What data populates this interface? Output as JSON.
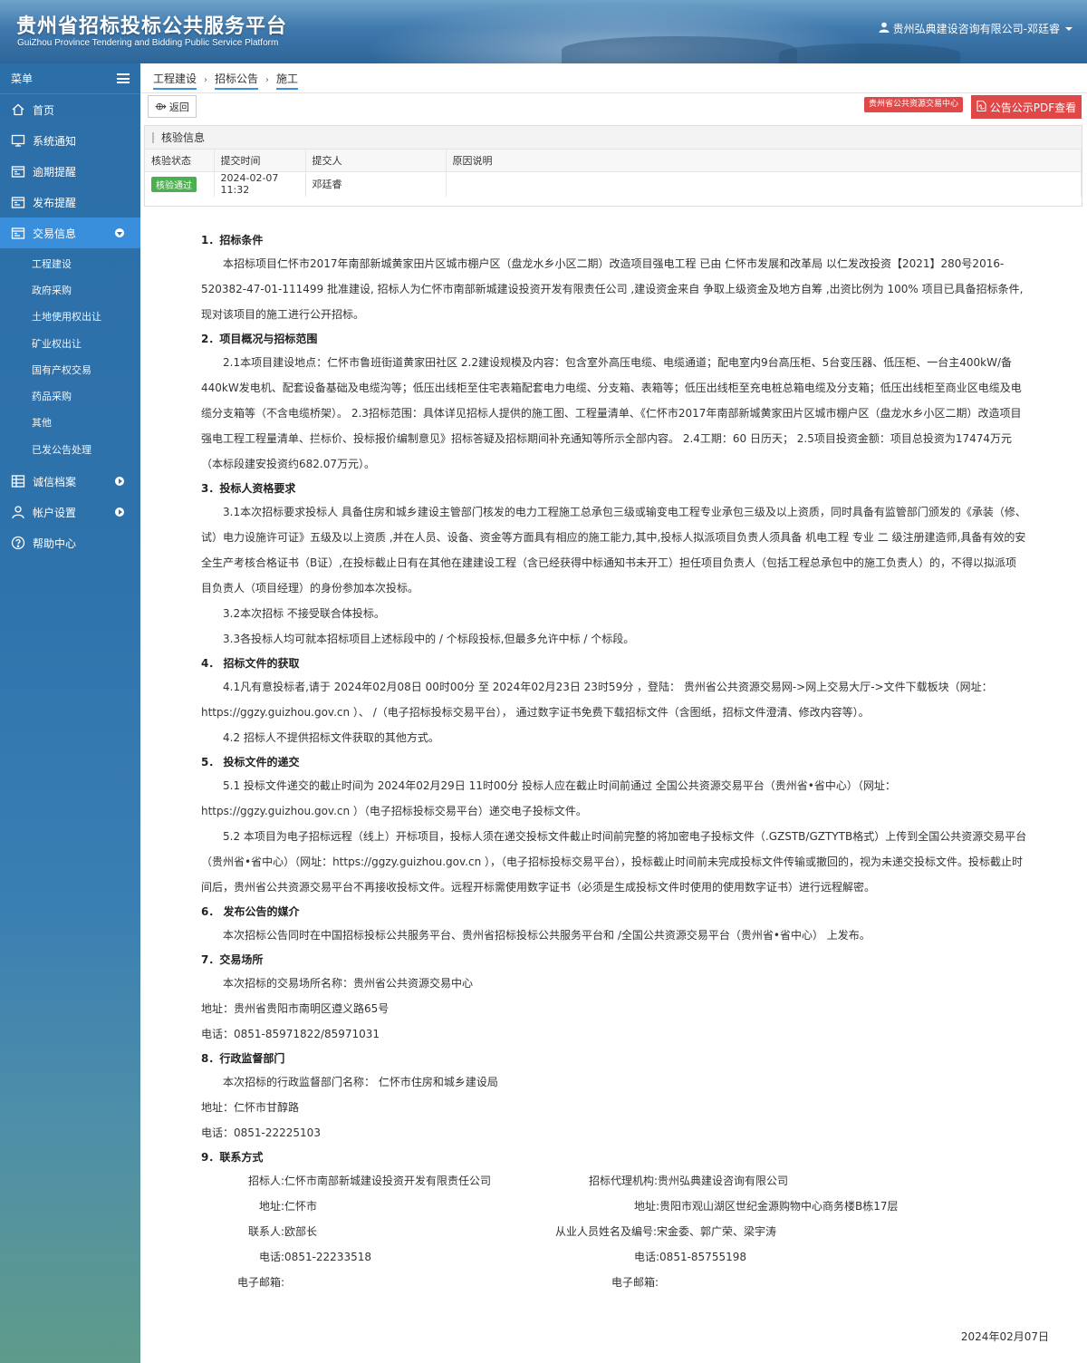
{
  "header": {
    "title": "贵州省招标投标公共服务平台",
    "subtitle": "GuiZhou Province Tendering and Bidding Public Service Platform",
    "user": "贵州弘典建设咨询有限公司-邓廷睿"
  },
  "sidebar": {
    "title": "菜单",
    "items": [
      {
        "label": "首页",
        "icon": "home-icon"
      },
      {
        "label": "系统通知",
        "icon": "monitor-icon"
      },
      {
        "label": "逾期提醒",
        "icon": "calendar-icon"
      },
      {
        "label": "发布提醒",
        "icon": "calendar-icon"
      },
      {
        "label": "交易信息",
        "icon": "calendar-icon"
      },
      {
        "label": "诚信档案",
        "icon": "grid-icon"
      },
      {
        "label": "帐户设置",
        "icon": "user-icon"
      },
      {
        "label": "帮助中心",
        "icon": "help-icon"
      }
    ],
    "sub_items": [
      "工程建设",
      "政府采购",
      "土地使用权出让",
      "矿业权出让",
      "国有产权交易",
      "药品采购",
      "其他",
      "已发公告处理"
    ]
  },
  "breadcrumb": [
    "工程建设",
    "招标公告",
    "施工"
  ],
  "toolbar": {
    "back": "返回",
    "source_tag": "贵州省公共资源交易中心",
    "pdf": "公告公示PDF查看"
  },
  "verify": {
    "title": "核验信息",
    "headers": [
      "核验状态",
      "提交时间",
      "提交人",
      "原因说明"
    ],
    "row": {
      "status": "核验通过",
      "time": "2024-02-07 11:32",
      "submitter": "邓廷睿",
      "reason": ""
    }
  },
  "notice": {
    "s1_title": "1．招标条件",
    "s1_p1": "本招标项目仁怀市2017年南部新城黄家田片区城市棚户区（盘龙水乡小区二期）改造项目强电工程 已由 仁怀市发展和改革局 以仁发改投资【2021】280号2016-520382-47-01-111499 批准建设, 招标人为仁怀市南部新城建设投资开发有限责任公司 ,建设资金来自 争取上级资金及地方自筹 ,出资比例为 100% 项目已具备招标条件,现对该项目的施工进行公开招标。",
    "s2_title": "2．项目概况与招标范围",
    "s2_p1": "2.1本项目建设地点：仁怀市鲁班街道黄家田社区 2.2建设规模及内容：包含室外高压电缆、电缆通道；配电室内9台高压柜、5台变压器、低压柜、一台主400kW/备440kW发电机、配套设备基础及电缆沟等；低压出线柜至住宅表箱配套电力电缆、分支箱、表箱等；低压出线柜至充电桩总箱电缆及分支箱；低压出线柜至商业区电缆及电缆分支箱等（不含电缆桥架）。 2.3招标范围：具体详见招标人提供的施工图、工程量清单、《仁怀市2017年南部新城黄家田片区城市棚户区（盘龙水乡小区二期）改造项目强电工程工程量清单、拦标价、投标报价编制意见》招标答疑及招标期间补充通知等所示全部内容。 2.4工期：60 日历天； 2.5项目投资金额：项目总投资为17474万元（本标段建安投资约682.07万元）。",
    "s3_title": "3．投标人资格要求",
    "s3_p1": "3.1本次招标要求投标人 具备住房和城乡建设主管部门核发的电力工程施工总承包三级或输变电工程专业承包三级及以上资质，同时具备有监管部门颁发的《承装（修、试）电力设施许可证》五级及以上资质 ,并在人员、设备、资金等方面具有相应的施工能力,其中,投标人拟派项目负责人须具备 机电工程 专业 二 级注册建造师,具备有效的安全生产考核合格证书（B证）,在投标截止日有在其他在建建设工程（含已经获得中标通知书未开工）担任项目负责人（包括工程总承包中的施工负责人）的，不得以拟派项目负责人（项目经理）的身份参加本次投标。",
    "s3_p2": "3.2本次招标 不接受联合体投标。",
    "s3_p3": "3.3各投标人均可就本招标项目上述标段中的 / 个标段投标,但最多允许中标 / 个标段。",
    "s4_title": "4． 招标文件的获取",
    "s4_p1": "4.1凡有意投标者,请于 2024年02月08日 00时00分 至 2024年02月23日 23时59分 ，登陆： 贵州省公共资源交易网->网上交易大厅->文件下载板块（网址：https://ggzy.guizhou.gov.cn ）、 /（电子招标投标交易平台）， 通过数字证书免费下载招标文件（含图纸，招标文件澄清、修改内容等）。",
    "s4_p2": "4.2 招标人不提供招标文件获取的其他方式。",
    "s5_title": "5． 投标文件的递交",
    "s5_p1": "5.1 投标文件递交的截止时间为 2024年02月29日 11时00分 投标人应在截止时间前通过 全国公共资源交易平台（贵州省•省中心）（网址：https://ggzy.guizhou.gov.cn ）（电子招标投标交易平台）递交电子投标文件。",
    "s5_p2": "5.2 本项目为电子招标远程（线上）开标项目，投标人须在递交投标文件截止时间前完整的将加密电子投标文件（.GZSTB/GZTYTB格式）上传到全国公共资源交易平台（贵州省•省中心）（网址：https://ggzy.guizhou.gov.cn ），（电子招标投标交易平台），投标截止时间前未完成投标文件传输或撤回的，视为未递交投标文件。投标截止时间后，贵州省公共资源交易平台不再接收投标文件。远程开标需使用数字证书（必须是生成投标文件时使用的使用数字证书）进行远程解密。",
    "s6_title": "6． 发布公告的媒介",
    "s6_p1": "本次招标公告同时在中国招标投标公共服务平台、贵州省招标投标公共服务平台和 /全国公共资源交易平台（贵州省•省中心） 上发布。",
    "s7_title": "7．交易场所",
    "s7_p1": "本次招标的交易场所名称：贵州省公共资源交易中心",
    "s7_p2": "地址：贵州省贵阳市南明区遵义路65号",
    "s7_p3": "电话：0851-85971822/85971031",
    "s8_title": "8．行政监督部门",
    "s8_p1": "本次招标的行政监督部门名称： 仁怀市住房和城乡建设局",
    "s8_p2": "地址：仁怀市甘醇路",
    "s8_p3": "电话：0851-22225103",
    "s9_title": "9．联系方式",
    "contact_left": [
      "招标人:仁怀市南部新城建设投资开发有限责任公司",
      "地址:仁怀市",
      "联系人:欧部长",
      "电话:0851-22233518",
      "电子邮箱:"
    ],
    "contact_right": [
      "招标代理机构:贵州弘典建设咨询有限公司",
      "地址:贵阳市观山湖区世纪金源购物中心商务楼B栋17层",
      "从业人员姓名及编号:宋金委、郭广荣、梁宇涛",
      "电话:0851-85755198",
      "电子邮箱:"
    ],
    "date": "2024年02月07日"
  }
}
